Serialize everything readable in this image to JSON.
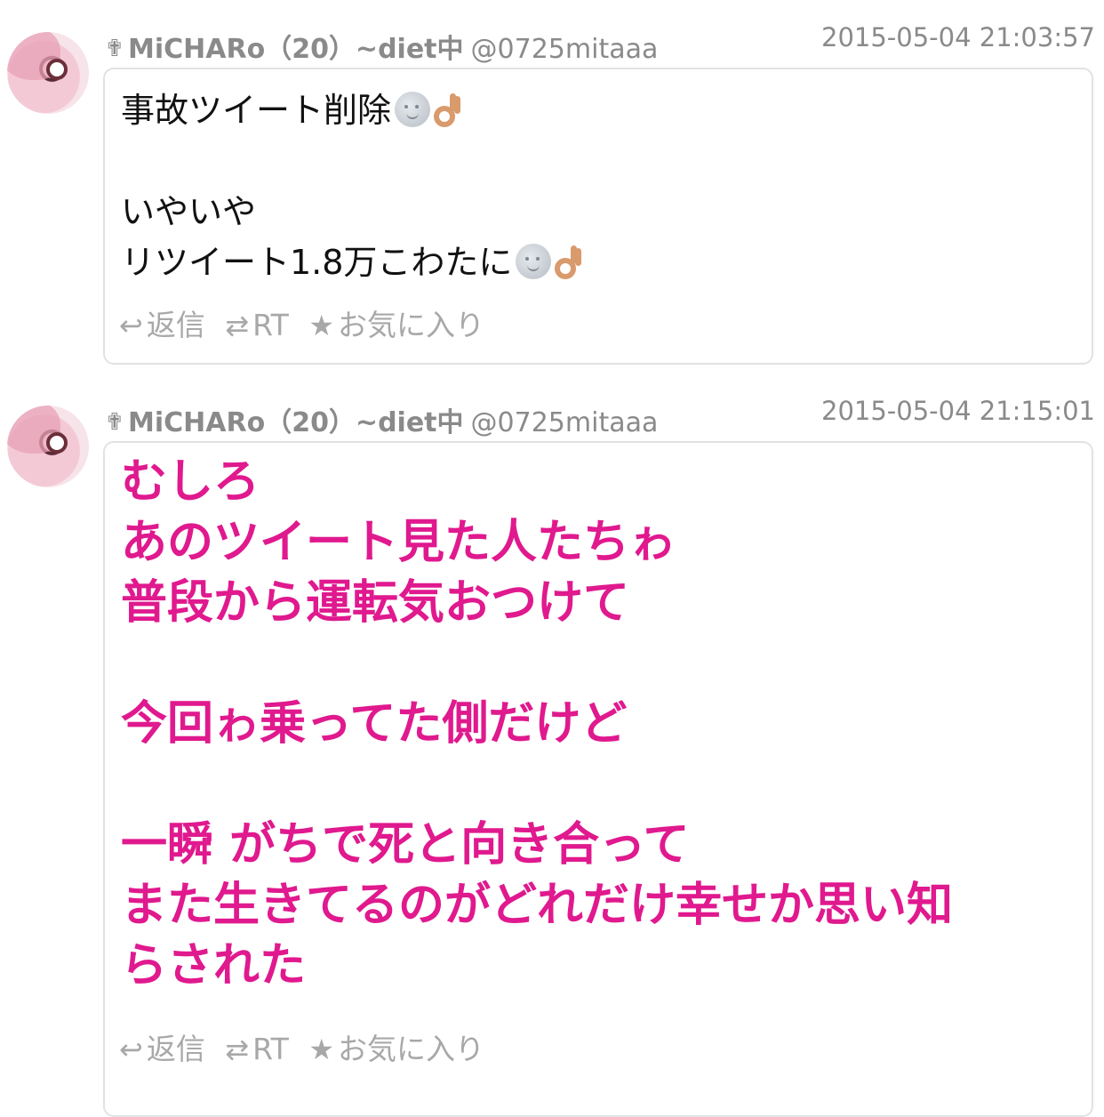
{
  "tweets": [
    {
      "name": "MiCHARo（20）~diet中",
      "handle": "@0725mitaaa",
      "timestamp": "2015-05-04 21:03:57",
      "lines": [
        "事故ツイート削除",
        "",
        "いやいや",
        "リツイート1.8万こわたに"
      ],
      "emoji": [
        "moon-face-icon",
        "ok-hand-icon"
      ],
      "actions": {
        "reply": "返信",
        "retweet": "RT",
        "favorite": "お気に入り"
      }
    },
    {
      "name": "MiCHARo（20）~diet中",
      "handle": "@0725mitaaa",
      "timestamp": "2015-05-04 21:15:01",
      "text": "むしろ\nあのツイート見た人たちゎ\n普段から運転気おつけて\n\n今回ゎ乗ってた側だけど\n\n一瞬 がちで死と向き合って\nまた生きてるのがどれだけ幸せか思い知\nらされた",
      "text_color": "#e0198e",
      "actions": {
        "reply": "返信",
        "retweet": "RT",
        "favorite": "お気に入り"
      }
    }
  ],
  "colors": {
    "meta_text": "#8a8a8a",
    "action_text": "#a8a8a8",
    "box_border": "#e2e2e2",
    "highlight_text": "#e0198e"
  }
}
